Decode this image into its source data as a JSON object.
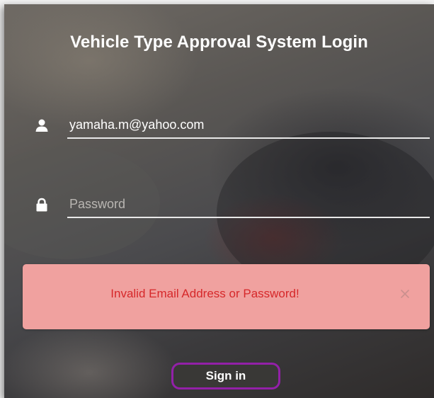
{
  "title": "Vehicle Type Approval System Login",
  "email": {
    "value": "yamaha.m@yahoo.com",
    "icon": "user-icon"
  },
  "password": {
    "value": "",
    "placeholder": "Password",
    "icon": "lock-icon"
  },
  "alert": {
    "message": "Invalid Email Address or Password!",
    "close_icon": "close-icon",
    "background": "#f0a19f",
    "text_color": "#d6282a"
  },
  "signin": {
    "label": "Sign in",
    "border_color": "#9320a8"
  }
}
